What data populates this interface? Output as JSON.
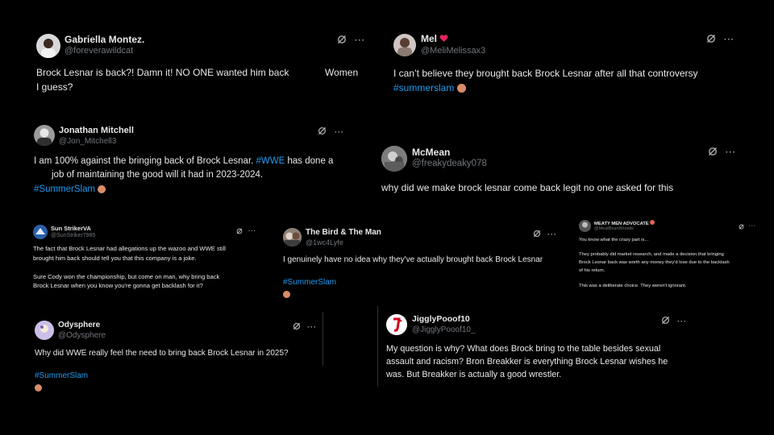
{
  "posts": [
    {
      "name": "Gabriella Montez.",
      "handle": "@foreverawildcat",
      "text": "Brock Lesnar is back?!  Damn it! NO ONE wanted him back",
      "text2": "I guess?",
      "side_text": "Women"
    },
    {
      "name": "Mel",
      "handle": "@MeliMelissax3",
      "text": "I can’t believe they brought back Brock Lesnar after all that controversy",
      "tag": "#summerslam"
    },
    {
      "name": "Jonathan Mitchell",
      "handle": "@Jon_Mitchell3",
      "text_a": "I am 100% against the bringing back of Brock Lesnar.",
      "tag_inline": "#WWE",
      "text_b": "has done a",
      "text_c": "job of maintaining the good will it had in 2023-2024.",
      "tag": "#SummerSlam"
    },
    {
      "name": "McMean",
      "handle": "@freakydeaky078",
      "text": "why did we make brock lesnar come back legit no one asked for this"
    },
    {
      "name": "Sun StrikerVA",
      "handle": "@SunStriker7985",
      "para1_line1": "The fact that Brock Lesnar had allegations up the wazoo and WWE still",
      "para1_line2": "brought him back should tell you that this company is a joke.",
      "para2_line1": "Sure Cody won the championship, but come on man, why bring back",
      "para2_line2": "Brock Lesnar when you know you're gonna get backlash for it?"
    },
    {
      "name": "The Bird & The Man",
      "handle": "@1wc4Lyfe",
      "text": "I genuinely have no idea why they've actually brought back Brock Lesnar",
      "tag": "#SummerSlam"
    },
    {
      "name": "MEATY MEN ADVOCATE",
      "handle": "@MeatBeanWrestle",
      "line1": "You know what the crazy part is...",
      "line2": "They probably did market research, and made a decision that bringing",
      "line3": "Brock Lesnar back was worth any money they'd lose due to the backlash",
      "line4": "of his return.",
      "line5": "This was a deliberate choice. They weren't ignorant."
    },
    {
      "name": "Odysphere",
      "handle": "@Odysphere",
      "text": "Why did WWE really feel the need to bring back Brock Lesnar in 2025?",
      "tag": "#SummerSlam"
    },
    {
      "name": "JigglyPooof10",
      "handle": "@JigglyPooof10_",
      "line1": "My question is why? What does Brock bring to the table besides sexual",
      "line2": "assault and racism? Bron Breakker is everything Brock Lesnar wishes he",
      "line3": "was. But Breakker is actually a good wrestler."
    }
  ],
  "icons": {
    "grok": "grok-icon",
    "more": "···",
    "tag_emoji": "summerslam-emoji-icon",
    "mel_badge": "red-heart-emoji-icon",
    "meaty_badge": "emoji-badge-icon"
  },
  "colors": {
    "background": "#000000",
    "text": "#e7e9ea",
    "muted": "#71767b",
    "link": "#1d9bf0",
    "divider": "#2f3336"
  }
}
